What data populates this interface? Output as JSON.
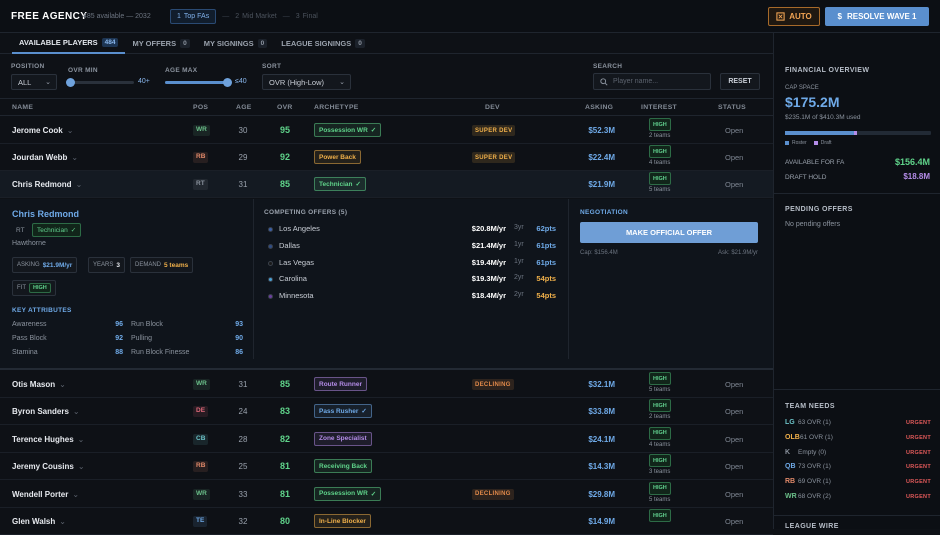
{
  "header": {
    "title": "FREE AGENCY",
    "subtitle": "485 available — 2032",
    "steps": [
      {
        "num": "1",
        "label": "Top FAs",
        "active": true
      },
      {
        "num": "2",
        "label": "Mid Market",
        "active": false
      },
      {
        "num": "3",
        "label": "Final",
        "active": false
      }
    ],
    "auto_label": "AUTO",
    "resolve_label": "RESOLVE WAVE 1"
  },
  "tabs": [
    {
      "label": "AVAILABLE PLAYERS",
      "count": "484"
    },
    {
      "label": "MY OFFERS",
      "count": "0"
    },
    {
      "label": "MY SIGNINGS",
      "count": "0"
    },
    {
      "label": "LEAGUE SIGNINGS",
      "count": "0"
    }
  ],
  "filters": {
    "position_label": "POSITION",
    "position_value": "ALL",
    "ovr_min_label": "OVR MIN",
    "ovr_min_value": "40+",
    "ovr_min_level": 0.0,
    "age_max_label": "AGE MAX",
    "age_max_value": "≤40",
    "age_max_level": 1.0,
    "sort_label": "SORT",
    "sort_value": "OVR (High-Low)",
    "search_label": "SEARCH",
    "search_placeholder": "Player name...",
    "reset_label": "RESET"
  },
  "columns": [
    "NAME",
    "POS",
    "AGE",
    "OVR",
    "ARCHETYPE",
    "DEV",
    "ASKING",
    "INTEREST",
    "STATUS"
  ],
  "colors": {
    "WR": "#6bc08a",
    "RB": "#e28a6a",
    "RT": "#8b939e",
    "DE": "#e06a7a",
    "CB": "#6cc3c8",
    "TE": "#6faae8",
    "green": "#5fd38a",
    "orange": "#f0b04a",
    "blue": "#6faae8",
    "purple": "#b48ce8",
    "red": "#e25a5a"
  },
  "players_top": [
    {
      "name": "Jerome Cook",
      "pos": "WR",
      "age": "30",
      "ovr": "95",
      "arch": "Possession WR",
      "arch_check": true,
      "arch_color": "green",
      "dev": "SUPER DEV",
      "ask": "$52.3M",
      "interest": "HIGH",
      "teams": "2 teams",
      "status": "Open"
    },
    {
      "name": "Jourdan Webb",
      "pos": "RB",
      "age": "29",
      "ovr": "92",
      "arch": "Power Back",
      "arch_check": false,
      "arch_color": "orange",
      "dev": "SUPER DEV",
      "ask": "$22.4M",
      "interest": "HIGH",
      "teams": "4 teams",
      "status": "Open"
    },
    {
      "name": "Chris Redmond",
      "pos": "RT",
      "age": "31",
      "ovr": "85",
      "arch": "Technician",
      "arch_check": true,
      "arch_color": "green",
      "dev": "",
      "ask": "$21.9M",
      "interest": "HIGH",
      "teams": "5 teams",
      "status": "Open"
    }
  ],
  "detail": {
    "name": "Chris Redmond",
    "pos": "RT",
    "arch": "Technician",
    "college": "Hawthorne",
    "asking_k": "ASKING",
    "asking_v": "$21.9M/yr",
    "years_k": "YEARS",
    "years_v": "3",
    "demand_k": "DEMAND",
    "demand_v": "5 teams",
    "fit_k": "FIT",
    "fit_v": "HIGH",
    "key_attr_title": "KEY ATTRIBUTES",
    "attributes": [
      {
        "name": "Awareness",
        "value": "96"
      },
      {
        "name": "Run Block",
        "value": "93"
      },
      {
        "name": "Pass Block",
        "value": "92"
      },
      {
        "name": "Pulling",
        "value": "90"
      },
      {
        "name": "Stamina",
        "value": "88"
      },
      {
        "name": "Run Block Finesse",
        "value": "86"
      }
    ],
    "competing_title": "COMPETING OFFERS (5)",
    "offers": [
      {
        "team": "Los Angeles",
        "dot": "#3b5fa8",
        "amount": "$20.8M/yr",
        "years": "3yr",
        "pts": "62pts",
        "pts_color": "blue"
      },
      {
        "team": "Dallas",
        "dot": "#2f4d86",
        "amount": "$21.4M/yr",
        "years": "1yr",
        "pts": "61pts",
        "pts_color": "blue"
      },
      {
        "team": "Las Vegas",
        "dot": "#1a1a1a",
        "amount": "$19.4M/yr",
        "years": "1yr",
        "pts": "61pts",
        "pts_color": "blue"
      },
      {
        "team": "Carolina",
        "dot": "#4aa3d8",
        "amount": "$19.3M/yr",
        "years": "2yr",
        "pts": "54pts",
        "pts_color": "orange"
      },
      {
        "team": "Minnesota",
        "dot": "#6b3fa0",
        "amount": "$18.4M/yr",
        "years": "2yr",
        "pts": "54pts",
        "pts_color": "orange"
      }
    ],
    "negotiation_title": "NEGOTIATION",
    "offer_button": "MAKE OFFICIAL OFFER",
    "cap_note": "Cap: $156.4M",
    "ask_note": "Ask: $21.9M/yr"
  },
  "players_bottom": [
    {
      "name": "Otis Mason",
      "pos": "WR",
      "age": "31",
      "ovr": "85",
      "arch": "Route Runner",
      "arch_check": false,
      "arch_color": "purple",
      "dev": "DECLINING",
      "ask": "$32.1M",
      "interest": "HIGH",
      "teams": "5 teams",
      "status": "Open"
    },
    {
      "name": "Byron Sanders",
      "pos": "DE",
      "age": "24",
      "ovr": "83",
      "arch": "Pass Rusher",
      "arch_check": true,
      "arch_color": "blue",
      "dev": "",
      "ask": "$33.8M",
      "interest": "HIGH",
      "teams": "2 teams",
      "status": "Open"
    },
    {
      "name": "Terence Hughes",
      "pos": "CB",
      "age": "28",
      "ovr": "82",
      "arch": "Zone Specialist",
      "arch_check": false,
      "arch_color": "purple",
      "dev": "",
      "ask": "$24.1M",
      "interest": "HIGH",
      "teams": "4 teams",
      "status": "Open"
    },
    {
      "name": "Jeremy Cousins",
      "pos": "RB",
      "age": "25",
      "ovr": "81",
      "arch": "Receiving Back",
      "arch_check": false,
      "arch_color": "green",
      "dev": "",
      "ask": "$14.3M",
      "interest": "HIGH",
      "teams": "3 teams",
      "status": "Open"
    },
    {
      "name": "Wendell Porter",
      "pos": "WR",
      "age": "33",
      "ovr": "81",
      "arch": "Possession WR",
      "arch_check": true,
      "arch_color": "green",
      "dev": "DECLINING",
      "ask": "$29.8M",
      "interest": "HIGH",
      "teams": "5 teams",
      "status": "Open"
    },
    {
      "name": "Glen Walsh",
      "pos": "TE",
      "age": "32",
      "ovr": "80",
      "arch": "In-Line Blocker",
      "arch_check": false,
      "arch_color": "orange",
      "dev": "",
      "ask": "$14.9M",
      "interest": "HIGH",
      "teams": "",
      "status": "Open"
    }
  ],
  "sidebar": {
    "fin_title": "FINANCIAL OVERVIEW",
    "cap_label": "CAP SPACE",
    "cap_value": "$175.2M",
    "cap_used": "$235.1M of $410.3M used",
    "roster_share": 0.47,
    "draft_share": 0.02,
    "legend_roster": "Roster",
    "legend_draft": "Draft",
    "avail_label": "AVAILABLE FOR FA",
    "avail_value": "$156.4M",
    "hold_label": "DRAFT HOLD",
    "hold_value": "$18.8M",
    "pending_title": "PENDING OFFERS",
    "pending_text": "No pending offers",
    "needs_title": "TEAM NEEDS",
    "needs": [
      {
        "pos": "LG",
        "text": "63 OVR (1)",
        "urg": "URGENT",
        "color": "#6cc3c8"
      },
      {
        "pos": "OLB",
        "text": "61 OVR (1)",
        "urg": "URGENT",
        "color": "#f0b04a"
      },
      {
        "pos": "K",
        "text": "Empty (0)",
        "urg": "URGENT",
        "color": "#8b939e"
      },
      {
        "pos": "QB",
        "text": "73 OVR (1)",
        "urg": "URGENT",
        "color": "#6faae8"
      },
      {
        "pos": "RB",
        "text": "69 OVR (1)",
        "urg": "URGENT",
        "color": "#e28a6a"
      },
      {
        "pos": "WR",
        "text": "68 OVR (2)",
        "urg": "URGENT",
        "color": "#6bc08a"
      }
    ],
    "league_wire_title": "LEAGUE WIRE"
  }
}
